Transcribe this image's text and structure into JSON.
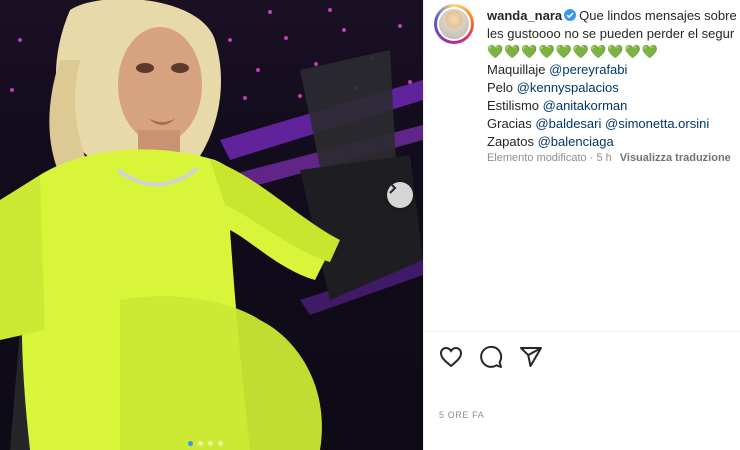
{
  "post": {
    "username": "wanda_nara",
    "caption_line1": "Que lindos mensajes sobre",
    "caption_line2": "les gustoooo no se pueden perder el segur",
    "hearts": "💚💚💚💚💚💚💚💚💚💚",
    "credits": [
      {
        "label": "Maquillaje",
        "mention": "@pereyrafabi"
      },
      {
        "label": "Pelo",
        "mention": "@kennyspalacios"
      },
      {
        "label": "Estilismo",
        "mention": "@anitakorman"
      },
      {
        "label": "Gracias",
        "mention": "@baldesari",
        "mention2": "@simonetta.orsini"
      },
      {
        "label": "Zapatos",
        "mention": "@balenciaga"
      }
    ],
    "edited_label": "Elemento modificato",
    "relative_time": "5 h",
    "translate_label": "Visualizza traduzione",
    "timestamp": "5 ORE FA"
  },
  "carousel": {
    "slide_count": 4,
    "active_index": 0
  },
  "icons": {
    "verified": "verified-badge-icon",
    "next": "chevron-right-icon",
    "like": "heart-icon",
    "comment": "comment-icon",
    "share": "paper-plane-icon"
  },
  "colors": {
    "verified": "#3897f0",
    "mention": "#00376b",
    "hearts": "#24c322",
    "outfit": "#d8f53a"
  }
}
